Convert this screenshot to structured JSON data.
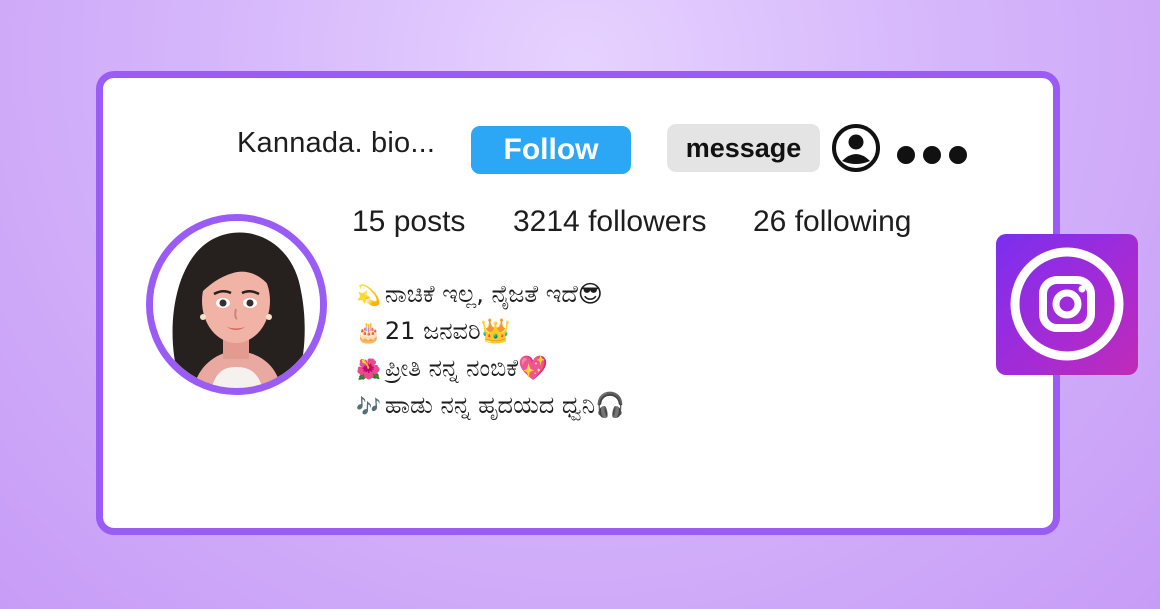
{
  "profile": {
    "username": "Kannada. bio...",
    "follow_label": "Follow",
    "message_label": "message"
  },
  "stats": {
    "posts": "15 posts",
    "followers": "3214 followers",
    "following": "26 following"
  },
  "bio": [
    {
      "emoji": "💫",
      "text": "ನಾಚಿಕೆ ಇಲ್ಲ, ನೈಜತೆ ಇದೆ😎"
    },
    {
      "emoji": "🎂",
      "text": "21 ಜನವರಿ👑"
    },
    {
      "emoji": "🌺",
      "text": "ಪ್ರೀತಿ ನನ್ನ ನಂಬಿಕೆ💖"
    },
    {
      "emoji": "🎶",
      "text": "ಹಾಡು ನನ್ನ ಹೃದಯದ ಧ್ವನಿ🎧"
    }
  ],
  "icons": {
    "user": "user-circle-icon",
    "more": "more-dots-icon",
    "instagram": "instagram-logo-icon"
  },
  "colors": {
    "accent": "#9b5cf6",
    "follow": "#2ba7f5",
    "message_bg": "#e4e4e4",
    "background": "#d5b6fb"
  }
}
